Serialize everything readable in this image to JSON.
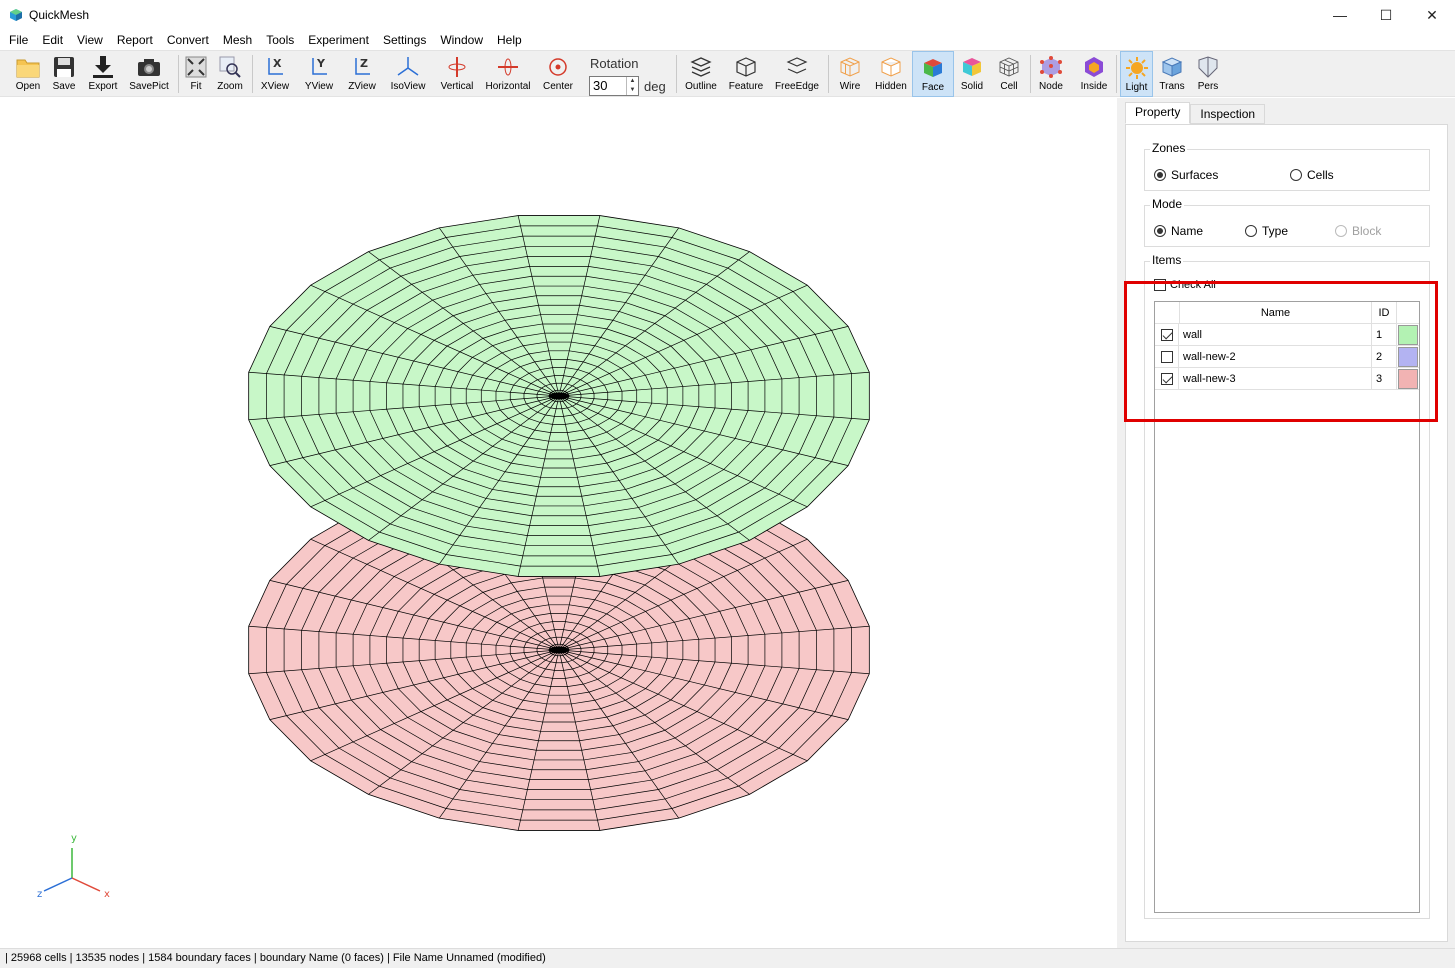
{
  "window": {
    "title": "QuickMesh",
    "controls": {
      "minimize": "—",
      "maximize": "☐",
      "close": "✕"
    }
  },
  "menu": [
    "File",
    "Edit",
    "View",
    "Report",
    "Convert",
    "Mesh",
    "Tools",
    "Experiment",
    "Settings",
    "Window",
    "Help"
  ],
  "toolbar": {
    "buttons": [
      {
        "label": "Open",
        "icon": "folder-icon"
      },
      {
        "label": "Save",
        "icon": "floppy-icon"
      },
      {
        "label": "Export",
        "icon": "download-icon"
      },
      {
        "label": "SavePict",
        "icon": "camera-icon"
      },
      {
        "label": "Fit",
        "icon": "fit-icon"
      },
      {
        "label": "Zoom",
        "icon": "zoom-icon"
      },
      {
        "label": "XView",
        "icon": "x-axis-view-icon"
      },
      {
        "label": "YView",
        "icon": "y-axis-view-icon"
      },
      {
        "label": "ZView",
        "icon": "z-axis-view-icon"
      },
      {
        "label": "IsoView",
        "icon": "iso-view-icon"
      },
      {
        "label": "Vertical",
        "icon": "vertical-rotate-icon"
      },
      {
        "label": "Horizontal",
        "icon": "horizontal-rotate-icon"
      },
      {
        "label": "Center",
        "icon": "center-icon"
      },
      {
        "label": "Outline",
        "icon": "outline-icon"
      },
      {
        "label": "Feature",
        "icon": "feature-icon"
      },
      {
        "label": "FreeEdge",
        "icon": "free-edge-icon"
      },
      {
        "label": "Wire",
        "icon": "wire-icon"
      },
      {
        "label": "Hidden",
        "icon": "hidden-icon"
      },
      {
        "label": "Face",
        "icon": "face-icon",
        "active": true
      },
      {
        "label": "Solid",
        "icon": "solid-icon"
      },
      {
        "label": "Cell",
        "icon": "cell-icon"
      },
      {
        "label": "Node",
        "icon": "node-icon"
      },
      {
        "label": "Inside",
        "icon": "inside-icon"
      },
      {
        "label": "Light",
        "icon": "light-icon",
        "active": true
      },
      {
        "label": "Trans",
        "icon": "trans-icon"
      },
      {
        "label": "Pers",
        "icon": "pers-icon"
      }
    ],
    "rotation": {
      "label": "Rotation",
      "value": "30",
      "unit": "deg"
    }
  },
  "panel": {
    "tabs": [
      {
        "label": "Property",
        "active": true
      },
      {
        "label": "Inspection",
        "active": false
      }
    ],
    "zones": {
      "title": "Zones",
      "options": [
        {
          "label": "Surfaces",
          "selected": true
        },
        {
          "label": "Cells",
          "selected": false
        }
      ]
    },
    "mode": {
      "title": "Mode",
      "options": [
        {
          "label": "Name",
          "selected": true
        },
        {
          "label": "Type",
          "selected": false
        },
        {
          "label": "Block",
          "selected": false,
          "disabled": true
        }
      ]
    },
    "items": {
      "title": "Items",
      "check_all": "Check All",
      "columns": {
        "name": "Name",
        "id": "ID"
      },
      "rows": [
        {
          "checked": true,
          "name": "wall",
          "id": "1",
          "color": "#b3f2b3"
        },
        {
          "checked": false,
          "name": "wall-new-2",
          "id": "2",
          "color": "#b3b3f2"
        },
        {
          "checked": true,
          "name": "wall-new-3",
          "id": "3",
          "color": "#f2b3b3"
        }
      ]
    }
  },
  "viewport": {
    "surfaces": [
      {
        "name": "wall",
        "fill": "#c8f7c8",
        "visible": true
      },
      {
        "name": "wall-new-3",
        "fill": "#f7c8c8",
        "visible": true
      }
    ],
    "axes": {
      "x": "x",
      "y": "y",
      "z": "z"
    }
  },
  "status": "| 25968 cells | 13535 nodes | 1584 boundary faces |  boundary Name  (0 faces) | File Name Unnamed (modified)"
}
